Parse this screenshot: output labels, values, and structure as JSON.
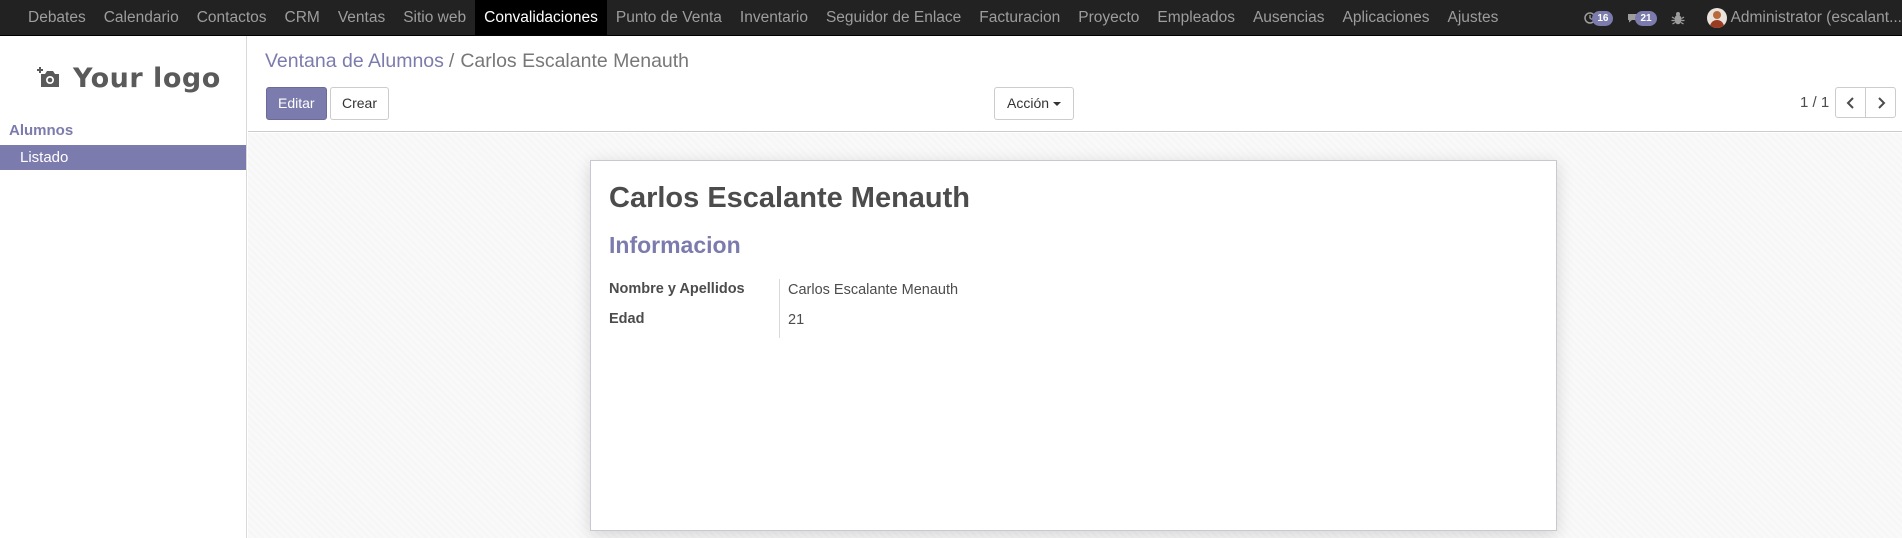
{
  "topbar": {
    "menu": [
      {
        "label": "Debates",
        "active": false
      },
      {
        "label": "Calendario",
        "active": false
      },
      {
        "label": "Contactos",
        "active": false
      },
      {
        "label": "CRM",
        "active": false
      },
      {
        "label": "Ventas",
        "active": false
      },
      {
        "label": "Sitio web",
        "active": false
      },
      {
        "label": "Convalidaciones",
        "active": true
      },
      {
        "label": "Punto de Venta",
        "active": false
      },
      {
        "label": "Inventario",
        "active": false
      },
      {
        "label": "Seguidor de Enlace",
        "active": false
      },
      {
        "label": "Facturacion",
        "active": false
      },
      {
        "label": "Proyecto",
        "active": false
      },
      {
        "label": "Empleados",
        "active": false
      },
      {
        "label": "Ausencias",
        "active": false
      },
      {
        "label": "Aplicaciones",
        "active": false
      },
      {
        "label": "Ajustes",
        "active": false
      }
    ],
    "activities_count": "16",
    "messages_count": "21",
    "user_name": "Administrator (escalant...",
    "icons": {
      "activities": "clock-icon",
      "messages": "chat-icon",
      "debug": "bug-icon"
    }
  },
  "sidebar": {
    "logo_text": "Your logo",
    "section_title": "Alumnos",
    "items": [
      {
        "label": "Listado",
        "active": true
      }
    ]
  },
  "control": {
    "breadcrumb_parent": "Ventana de Alumnos",
    "breadcrumb_separator": "/",
    "breadcrumb_current": "Carlos Escalante Menauth",
    "edit_label": "Editar",
    "create_label": "Crear",
    "action_label": "Acción",
    "pager_value": "1 / 1"
  },
  "form": {
    "title": "Carlos Escalante Menauth",
    "section_title": "Informacion",
    "fields": [
      {
        "label": "Nombre y Apellidos",
        "value": "Carlos Escalante Menauth"
      },
      {
        "label": "Edad",
        "value": "21"
      }
    ]
  },
  "colors": {
    "accent": "#7c7bad",
    "topbar_bg": "#222222",
    "topbar_active_bg": "#000000"
  }
}
